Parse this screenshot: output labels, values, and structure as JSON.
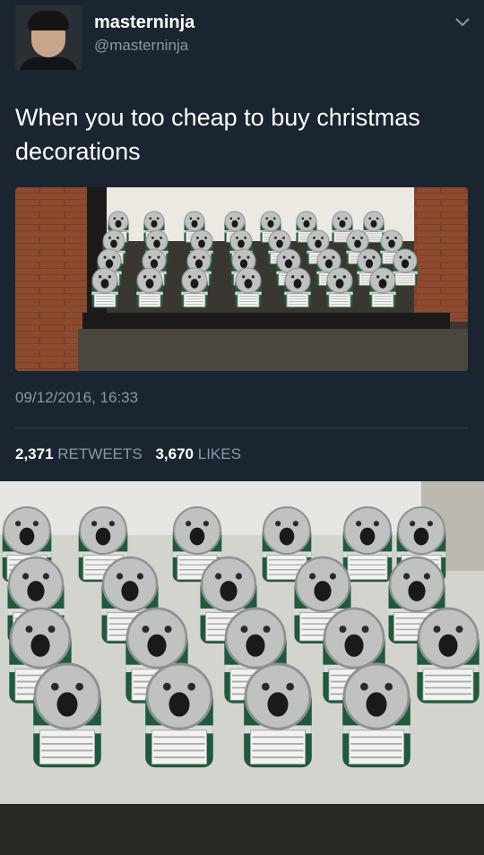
{
  "tweet": {
    "display_name": "masterninja",
    "handle": "@masterninja",
    "text": "When you too cheap to buy christmas decorations",
    "timestamp": "09/12/2016, 16:33",
    "retweets_count": "2,371",
    "retweets_label": "RETWEETS",
    "likes_count": "3,670",
    "likes_label": "LIKES",
    "menu_icon": "chevron-down-icon"
  },
  "colors": {
    "background": "#1b2532",
    "primary_text": "#ffffff",
    "secondary_text": "#8899a6",
    "divider": "#38444d"
  }
}
